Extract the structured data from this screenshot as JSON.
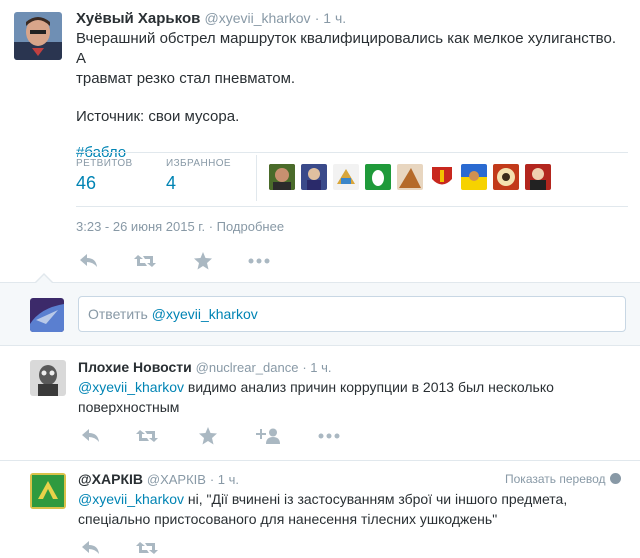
{
  "main_tweet": {
    "author_name": "Хуёвый Харьков",
    "author_handle": "@xyevii_kharkov",
    "time_ago": "· 1 ч.",
    "text_line1": "Вчерашний обстрел маршруток квалифицировались как мелкое хулиганство. А",
    "text_line2": "травмат резко стал пневматом.",
    "text_line3": "Источник: свои мусора.",
    "hashtag": "#бабло",
    "retweets_label": "РЕТВИТОВ",
    "retweets_count": "46",
    "favorites_label": "ИЗБРАННОЕ",
    "favorites_count": "4",
    "timestamp": "3:23 - 26 июня 2015 г.",
    "details_link": "· Подробнее"
  },
  "reply_box": {
    "placeholder_prefix": "Ответить ",
    "placeholder_handle": "@xyevii_kharkov"
  },
  "replies": [
    {
      "author_name": "Плохие Новости",
      "author_handle": "@nuclrear_dance",
      "time_ago": "· 1 ч.",
      "mention": "@xyevii_kharkov",
      "text_line1": " видимо анализ причин коррупции в 2013 был несколько",
      "text_line2": "поверхностным"
    },
    {
      "author_name": "@ХАРКІВ",
      "author_handle": "@ХАРКІВ",
      "time_ago": "· 1 ч.",
      "translate": "Показать перевод",
      "mention": "@xyevii_kharkov",
      "text_line1": " ні, \"Дії вчинені із застосуванням зброї чи іншого предмета,",
      "text_line2": "спеціально пристосованого для нанесення тілесних ушкоджень\""
    }
  ],
  "colors": {
    "link": "#0084b4",
    "muted": "#8899a6",
    "text": "#292f33",
    "divider": "#e1e8ed",
    "reply_bg": "#f5f8fa"
  }
}
